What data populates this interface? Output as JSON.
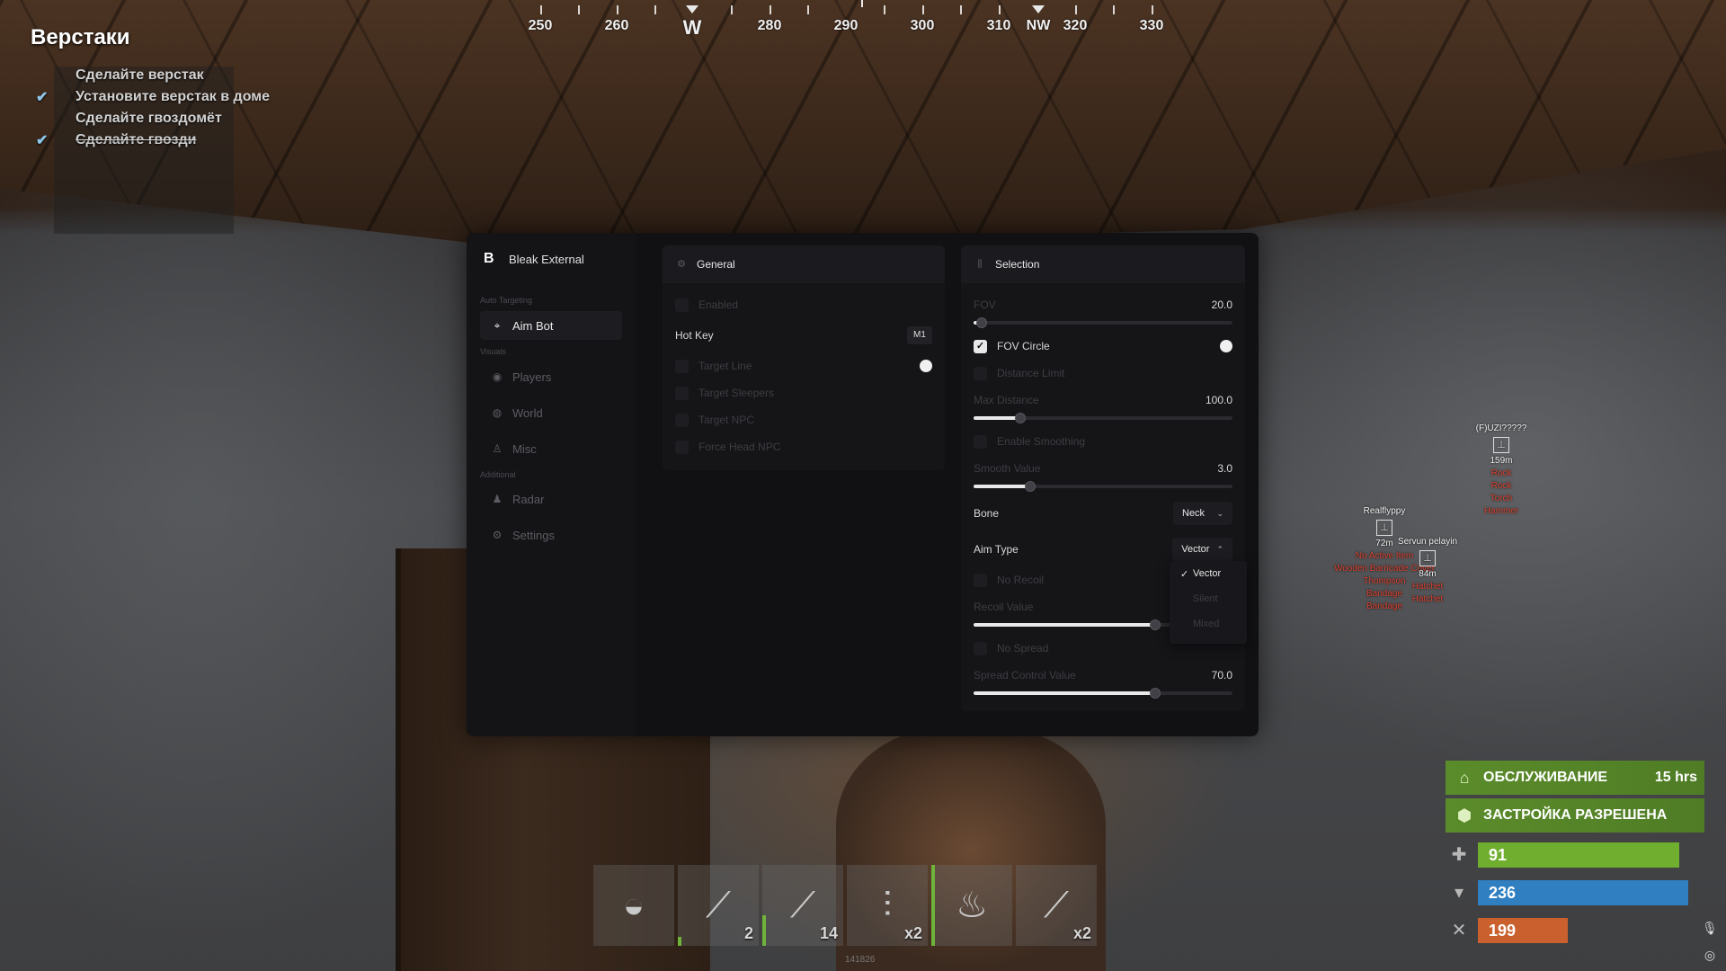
{
  "compass": {
    "labels": [
      "250",
      "260",
      "W",
      "280",
      "290",
      "300",
      "310",
      "NW",
      "320",
      "330"
    ]
  },
  "quests": {
    "title": "Верстаки",
    "items": [
      {
        "text": "Сделайте верстак",
        "done": false
      },
      {
        "text": "Установите верстак в доме",
        "done": true
      },
      {
        "text": "Сделайте гвоздомёт",
        "done": false
      },
      {
        "text": "Сделайте гвозди",
        "done": true
      }
    ]
  },
  "menu": {
    "brand": "Bleak External",
    "sections": {
      "auto_targeting": "Auto Targeting",
      "visuals": "Visuals",
      "additional": "Additional"
    },
    "nav": {
      "aimbot": "Aim Bot",
      "players": "Players",
      "world": "World",
      "misc": "Misc",
      "radar": "Radar",
      "settings": "Settings"
    },
    "general": {
      "title": "General",
      "enabled": "Enabled",
      "hotkey_label": "Hot Key",
      "hotkey_value": "M1",
      "target_line": "Target Line",
      "target_sleepers": "Target Sleepers",
      "target_npc": "Target NPC",
      "force_head_npc": "Force Head NPC"
    },
    "selection": {
      "title": "Selection",
      "fov_label": "FOV",
      "fov_value": "20.0",
      "fov_circle": "FOV Circle",
      "distance_limit": "Distance Limit",
      "max_distance_label": "Max Distance",
      "max_distance_value": "100.0",
      "enable_smoothing": "Enable Smoothing",
      "smooth_label": "Smooth Value",
      "smooth_value": "3.0",
      "bone_label": "Bone",
      "bone_value": "Neck",
      "aim_type_label": "Aim Type",
      "aim_type_value": "Vector",
      "no_recoil": "No Recoil",
      "recoil_label": "Recoil Value",
      "no_spread": "No Spread",
      "spread_label": "Spread Control Value",
      "spread_value": "70.0"
    },
    "sliders": {
      "fov_fraction": 0.03,
      "max_distance_fraction": 0.18,
      "smooth_fraction": 0.22,
      "recoil_fraction": 0.7,
      "spread_fraction": 0.7
    },
    "aim_type_options": [
      "Vector",
      "Silent",
      "Mixed"
    ]
  },
  "esp": {
    "player1": {
      "name": "(F)UZI?????",
      "distance": "159m",
      "items": [
        "Rock",
        "Rock",
        "Torch",
        "Hammer"
      ]
    },
    "player2": {
      "name": "Realflyppy",
      "distance": "72m",
      "items": [
        "No Active Item",
        "Wooden Barricade Cover",
        "Thompson",
        "Bandage",
        "Bandage"
      ]
    },
    "player3": {
      "name": "Servun pelayin",
      "distance": "84m",
      "items": [
        "Hatchet",
        "Hatchet"
      ]
    }
  },
  "status": {
    "upkeep_label": "ОБСЛУЖИВАНИЕ",
    "upkeep_value": "15 hrs",
    "building_label": "ЗАСТРОЙКА РАЗРЕШЕНА",
    "health": "91",
    "water": "236",
    "food": "199",
    "colors": {
      "health": "#6fae2e",
      "water": "#2f7fc1",
      "food": "#c9602d",
      "upkeep": "#5b8c2b"
    }
  },
  "hotbar": {
    "slots": [
      {
        "icon": "hide-icon",
        "qty": ""
      },
      {
        "icon": "rifle-icon",
        "qty": "2"
      },
      {
        "icon": "smg-icon",
        "qty": "14"
      },
      {
        "icon": "nails-icon",
        "qty": "x2"
      },
      {
        "icon": "torch-icon",
        "qty": ""
      },
      {
        "icon": "syringe-icon",
        "qty": "x2"
      }
    ],
    "id_text": "141826"
  }
}
